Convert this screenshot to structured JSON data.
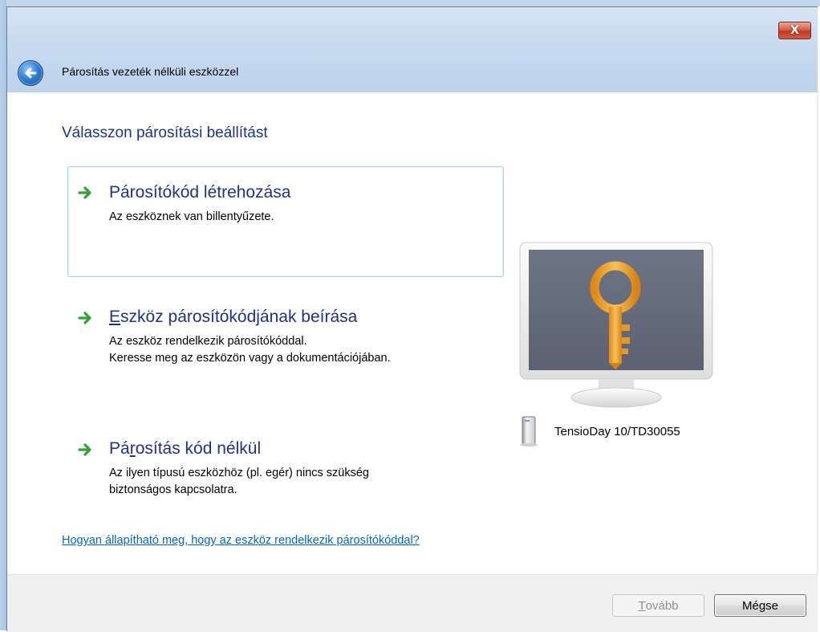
{
  "window": {
    "title": "Párosítás vezeték nélküli eszközzel",
    "close_symbol": "X"
  },
  "heading": "Válasszon párosítási beállítást",
  "options": [
    {
      "title_underlined": "",
      "title_rest": "Párosítókód létrehozása",
      "desc_lines": [
        "Az eszköznek van billentyűzete."
      ]
    },
    {
      "title_underlined": "E",
      "title_rest": "szköz párosítókódjának beírása",
      "desc_lines": [
        "Az eszköz rendelkezik párosítókóddal.",
        "Keresse meg az eszközön vagy a dokumentációjában."
      ]
    },
    {
      "title_prefix": "Pá",
      "title_underlined": "r",
      "title_rest": "osítás kód nélkül",
      "desc_lines": [
        "Az ilyen típusú eszközhöz (pl. egér) nincs szükség",
        "biztonságos kapcsolatra."
      ]
    }
  ],
  "help_link": "Hogyan állapítható meg, hogy az eszköz rendelkezik párosítókóddal?",
  "device": {
    "name": "TensioDay 10/TD30055",
    "icon": "device-tower-icon"
  },
  "buttons": {
    "next_underlined": "T",
    "next_rest": "ovább",
    "cancel": "Mégse"
  },
  "colors": {
    "heading": "#1e3287",
    "link": "#0066cc",
    "arrow": "#2ea52e",
    "selection_border": "#9bd5f2"
  }
}
